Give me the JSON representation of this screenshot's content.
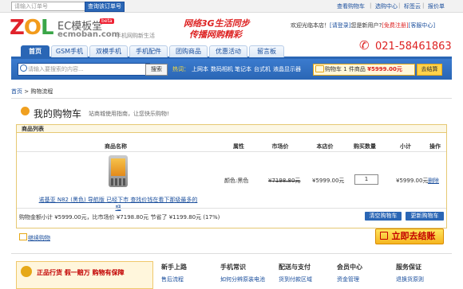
{
  "topbar": {
    "order_placeholder": "请输入订单号",
    "order_button": "查询该订单号",
    "links": [
      "查看购物车",
      "选购中心",
      "标签云",
      "报价单"
    ]
  },
  "header": {
    "logo_text": "ZOL",
    "site_name": "EC模板堂",
    "beta": "beta",
    "domain": "ecmoban.com",
    "tagline": "手机网购新生活",
    "slogan_line1": "网络3G生活同步",
    "slogan_line2": "传播网购精彩",
    "welcome": "欢迎光临本店！",
    "login_link": "[请登录]",
    "new_user_text": "您是新用户?",
    "register_link": "[免费注册]",
    "service_link": "[客服中心]",
    "phone": "021-58461863"
  },
  "nav": {
    "tabs": [
      "首页",
      "GSM手机",
      "双模手机",
      "手机配件",
      "团购商品",
      "优惠活动",
      "留言板"
    ],
    "active": 0
  },
  "search": {
    "placeholder": "请输入要搜索的内容...",
    "button": "搜索",
    "hot_label": "热词：",
    "hot_words": [
      "上网本",
      "数码相机",
      "笔记本",
      "台式机",
      "液晶显示器"
    ]
  },
  "cart_summary": {
    "label": "购物车",
    "count_text": "1 件商品",
    "amount": "¥5999.00元",
    "checkout": "去结算"
  },
  "breadcrumb": {
    "home": "首页",
    "sep": ">",
    "current": "购物流程"
  },
  "cart": {
    "title": "我的购物车",
    "tip": "站商城使用指南，让您快乐购物!",
    "list_title": "商品列表",
    "headers": [
      "商品名称",
      "属性",
      "市场价",
      "本店价",
      "购买数量",
      "小计",
      "操作"
    ],
    "items": [
      {
        "name": "诺基亚 N82 (黑色) 导航版 已经下市 查找价钱在看下那级最多的吧",
        "attr": "颜色:黑色",
        "market_price": "¥7198.80元",
        "shop_price": "¥5999.00元",
        "quantity": "1",
        "subtotal": "¥5999.00元",
        "action": "删除"
      }
    ],
    "summary": "购物金额小计 ¥5999.00元，比市场价 ¥7198.80元 节省了 ¥1199.80元 (17%)",
    "clear_button": "清空购物车",
    "update_button": "更新购物车",
    "continue_link": "继续购物",
    "settle_button": "立即去结账"
  },
  "footer": {
    "guarantee": "正品行货  假一赔万  购物有保障",
    "columns": [
      {
        "title": "新手上路",
        "item": "售后流程"
      },
      {
        "title": "手机常识",
        "item": "如何分辨原装电池"
      },
      {
        "title": "配送与支付",
        "item": "货到付款区域"
      },
      {
        "title": "会员中心",
        "item": "资金管理"
      },
      {
        "title": "服务保证",
        "item": "退换货原则"
      }
    ]
  },
  "colors": {
    "primary_blue": "#2a66b5",
    "accent_red": "#d22222",
    "accent_yellow": "#ffd24a"
  }
}
